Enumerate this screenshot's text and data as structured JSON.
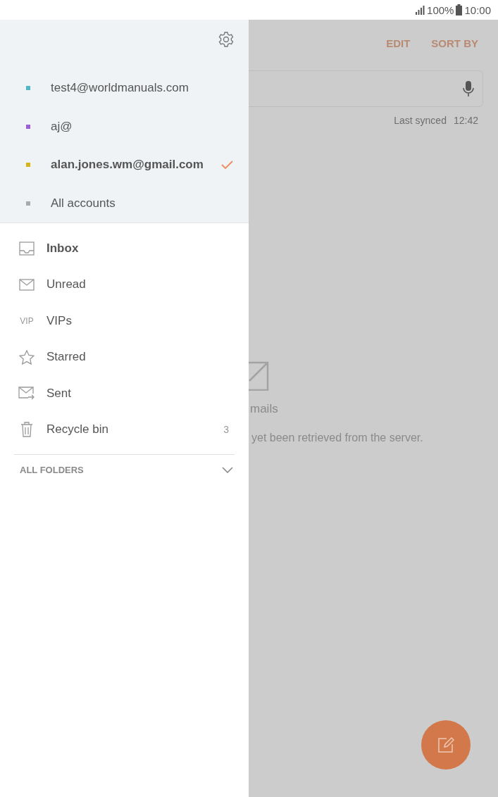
{
  "status_bar": {
    "battery": "100%",
    "time": "10:00"
  },
  "drawer": {
    "accounts": [
      {
        "name": "test4@worldmanuals.com",
        "color": "#4fb8c8",
        "selected": false
      },
      {
        "name": "aj@",
        "color": "#9a5fd8",
        "selected": false
      },
      {
        "name": "alan.jones.wm@gmail.com",
        "color": "#d4b417",
        "selected": true
      },
      {
        "name": "All accounts",
        "color": "#a9a9a9",
        "selected": false
      }
    ],
    "folders": [
      {
        "kind": "inbox",
        "label": "Inbox",
        "selected": true
      },
      {
        "kind": "unread",
        "label": "Unread",
        "selected": false
      },
      {
        "kind": "vip",
        "icon_text": "VIP",
        "label": "VIPs",
        "selected": false
      },
      {
        "kind": "starred",
        "label": "Starred",
        "selected": false
      },
      {
        "kind": "sent",
        "label": "Sent",
        "selected": false
      },
      {
        "kind": "recycle",
        "label": "Recycle bin",
        "count": "3",
        "selected": false
      }
    ],
    "all_folders": {
      "label": "ALL FOLDERS",
      "expanded": false
    }
  },
  "background": {
    "actions": [
      "EDIT",
      "SORT BY"
    ],
    "last_synced": {
      "label": "Last synced",
      "time": "12:42"
    },
    "empty_state": {
      "title": "mails",
      "message": "yet been retrieved from the server."
    }
  }
}
